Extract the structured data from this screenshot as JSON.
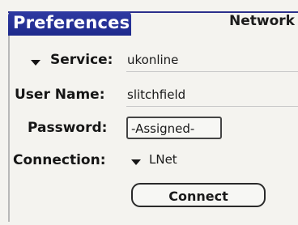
{
  "header": {
    "title": "Preferences",
    "category": "Network"
  },
  "form": {
    "service": {
      "label": "Service:",
      "value": "ukonline"
    },
    "user_name": {
      "label": "User Name:",
      "value": "slitchfield"
    },
    "password": {
      "label": "Password:",
      "value": "-Assigned-"
    },
    "connection": {
      "label": "Connection:",
      "value": "LNet"
    }
  },
  "actions": {
    "connect_label": "Connect"
  }
}
